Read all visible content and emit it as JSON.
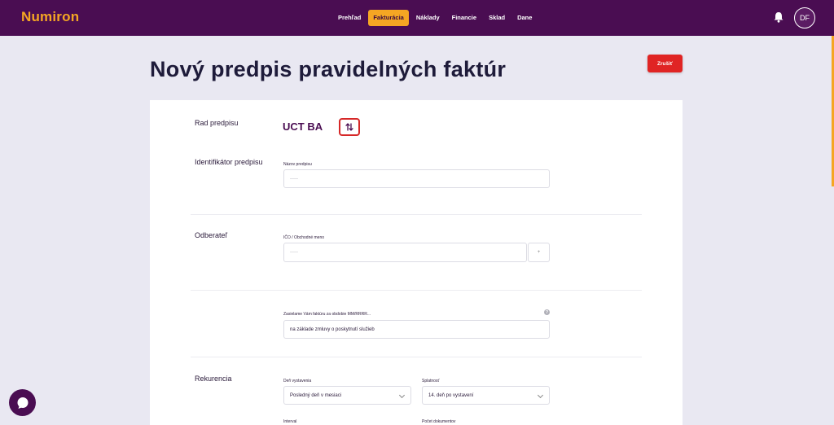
{
  "app": {
    "logo": "Numiron"
  },
  "nav": {
    "items": [
      {
        "label": "Prehľad"
      },
      {
        "label": "Fakturácia"
      },
      {
        "label": "Náklady"
      },
      {
        "label": "Financie"
      },
      {
        "label": "Sklad"
      },
      {
        "label": "Dane"
      }
    ],
    "active": "Fakturácia"
  },
  "user": {
    "initials": "DF"
  },
  "page": {
    "title": "Nový predpis pravidelných faktúr",
    "cancel_label": "Zrušiť"
  },
  "form": {
    "series": {
      "label": "Rad predpisu",
      "value": "UCT BA"
    },
    "identifier": {
      "label": "Identifikátor predpisu",
      "name_label": "Názov predpisu",
      "name_placeholder": "-----"
    },
    "customer": {
      "label": "Odberateľ",
      "ico_label": "IČO / Obchodné meno",
      "ico_placeholder": "-----",
      "side_button": "+"
    },
    "intro": {
      "label": "Zasielame Vám faktúru za obdobie MM/RRRR...",
      "value": "na základe zmluvy o poskytnutí služieb",
      "info": "?"
    },
    "recurrence": {
      "label": "Rekurencia",
      "issue_day_label": "Deň vystavenia",
      "issue_day_value": "Posledný deň v mesiaci",
      "due_label": "Splatnosť",
      "due_value": "14. deň po vystavení",
      "interval_label": "Interval",
      "doc_count_label": "Počet dokumentov"
    }
  },
  "colors": {
    "brand": "#4a0d52",
    "accent": "#f5a623",
    "danger": "#e02424"
  }
}
